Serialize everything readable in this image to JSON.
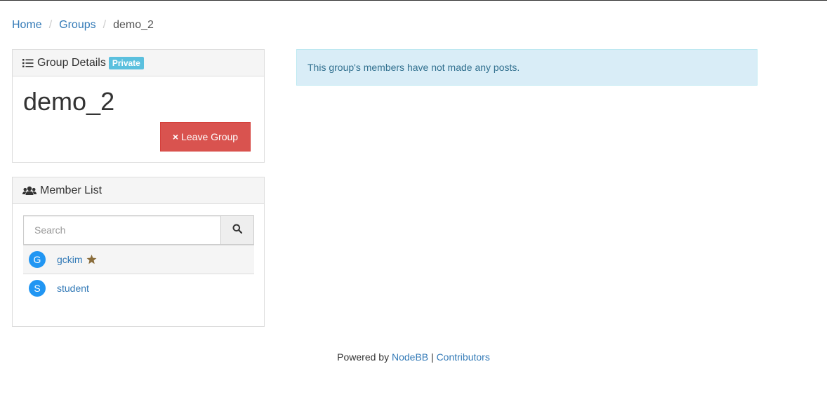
{
  "breadcrumb": {
    "items": [
      "Home",
      "Groups"
    ],
    "current": "demo_2",
    "separator": "/"
  },
  "group_details": {
    "heading": "Group Details",
    "badge": "Private",
    "name": "demo_2",
    "leave_button": "Leave Group",
    "leave_icon": "×"
  },
  "member_list": {
    "heading": "Member List",
    "search_placeholder": "Search",
    "members": [
      {
        "initial": "G",
        "name": "gckim",
        "owner": true
      },
      {
        "initial": "S",
        "name": "student",
        "owner": false
      }
    ]
  },
  "alert": {
    "text": "This group's members have not made any posts."
  },
  "footer": {
    "prefix": "Powered by",
    "link1": "NodeBB",
    "separator": "|",
    "link2": "Contributors"
  },
  "colors": {
    "link": "#337ab7",
    "danger": "#d9534f",
    "info_badge": "#5bc0de",
    "alert_bg": "#d9edf7",
    "avatar": "#2196f3",
    "star": "#8a6d3b"
  },
  "icons": {
    "details": "list-icon",
    "members": "users-icon",
    "search": "search-icon",
    "owner": "star-icon"
  }
}
